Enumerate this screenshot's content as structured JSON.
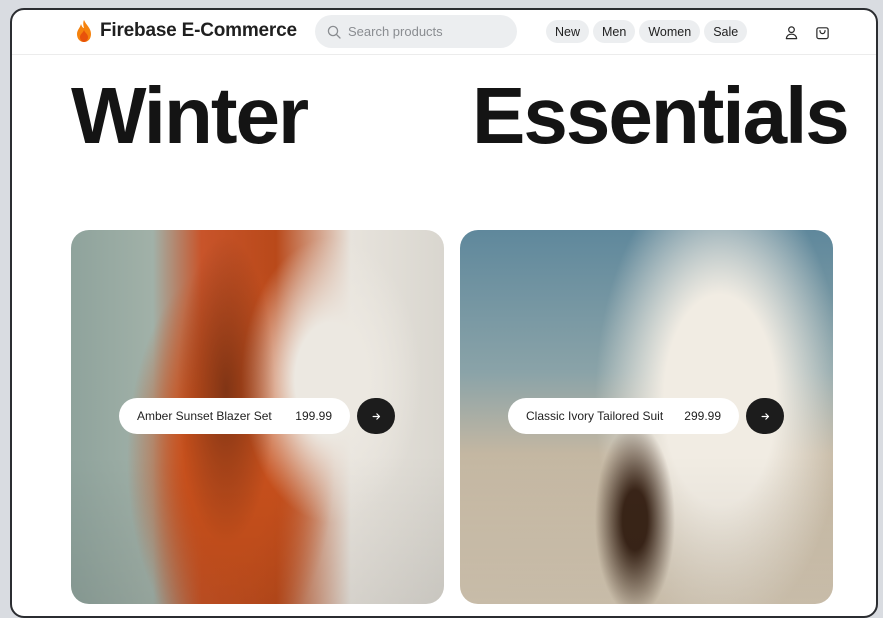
{
  "header": {
    "brand": "Firebase E-Commerce",
    "search_placeholder": "Search products",
    "nav": [
      "New",
      "Men",
      "Women",
      "Sale"
    ],
    "icons": [
      "account-icon",
      "cart-icon"
    ]
  },
  "hero": {
    "word_1": "Winter",
    "word_2": "Essentials"
  },
  "products": [
    {
      "name": "Amber Sunset Blazer Set",
      "price": "199.99"
    },
    {
      "name": "Classic Ivory Tailored Suit",
      "price": "299.99"
    }
  ],
  "colors": {
    "brand_flame": "#f5820d",
    "text_primary": "#141414",
    "pill_bg": "#eceef0",
    "action_button": "#1c1c1c"
  }
}
